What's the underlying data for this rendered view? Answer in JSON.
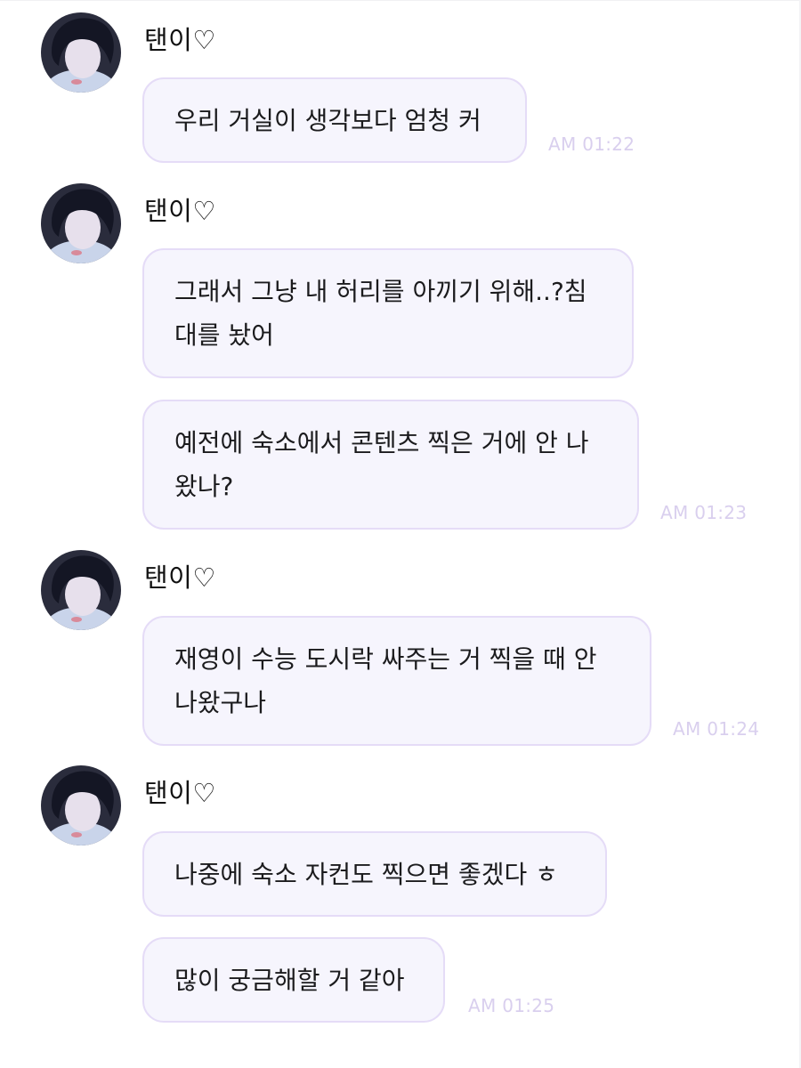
{
  "colors": {
    "bubble_bg": "#f6f5fd",
    "bubble_border": "#e5dcf7",
    "timestamp": "#d9cfee",
    "sender": "#111111",
    "message_text": "#1b1b1d"
  },
  "groups": [
    {
      "sender": "탠이♡",
      "avatar_icon": "profile-photo",
      "messages": [
        "우리 거실이 생각보다 엄청 커"
      ],
      "time": "AM 01:22"
    },
    {
      "sender": "탠이♡",
      "avatar_icon": "profile-photo",
      "messages": [
        "그래서 그냥 내 허리를 아끼기 위해..?침\n대를 놨어",
        "예전에 숙소에서 콘텐츠 찍은 거에 안 나\n왔나?"
      ],
      "time": "AM 01:23"
    },
    {
      "sender": "탠이♡",
      "avatar_icon": "profile-photo",
      "messages": [
        "재영이 수능 도시락 싸주는 거 찍을 때 안\n나왔구나"
      ],
      "time": "AM 01:24"
    },
    {
      "sender": "탠이♡",
      "avatar_icon": "profile-photo",
      "messages": [
        "나중에 숙소 자컨도 찍으면 좋겠다 ㅎ",
        "많이 궁금해할 거 같아"
      ],
      "time": "AM 01:25"
    }
  ]
}
